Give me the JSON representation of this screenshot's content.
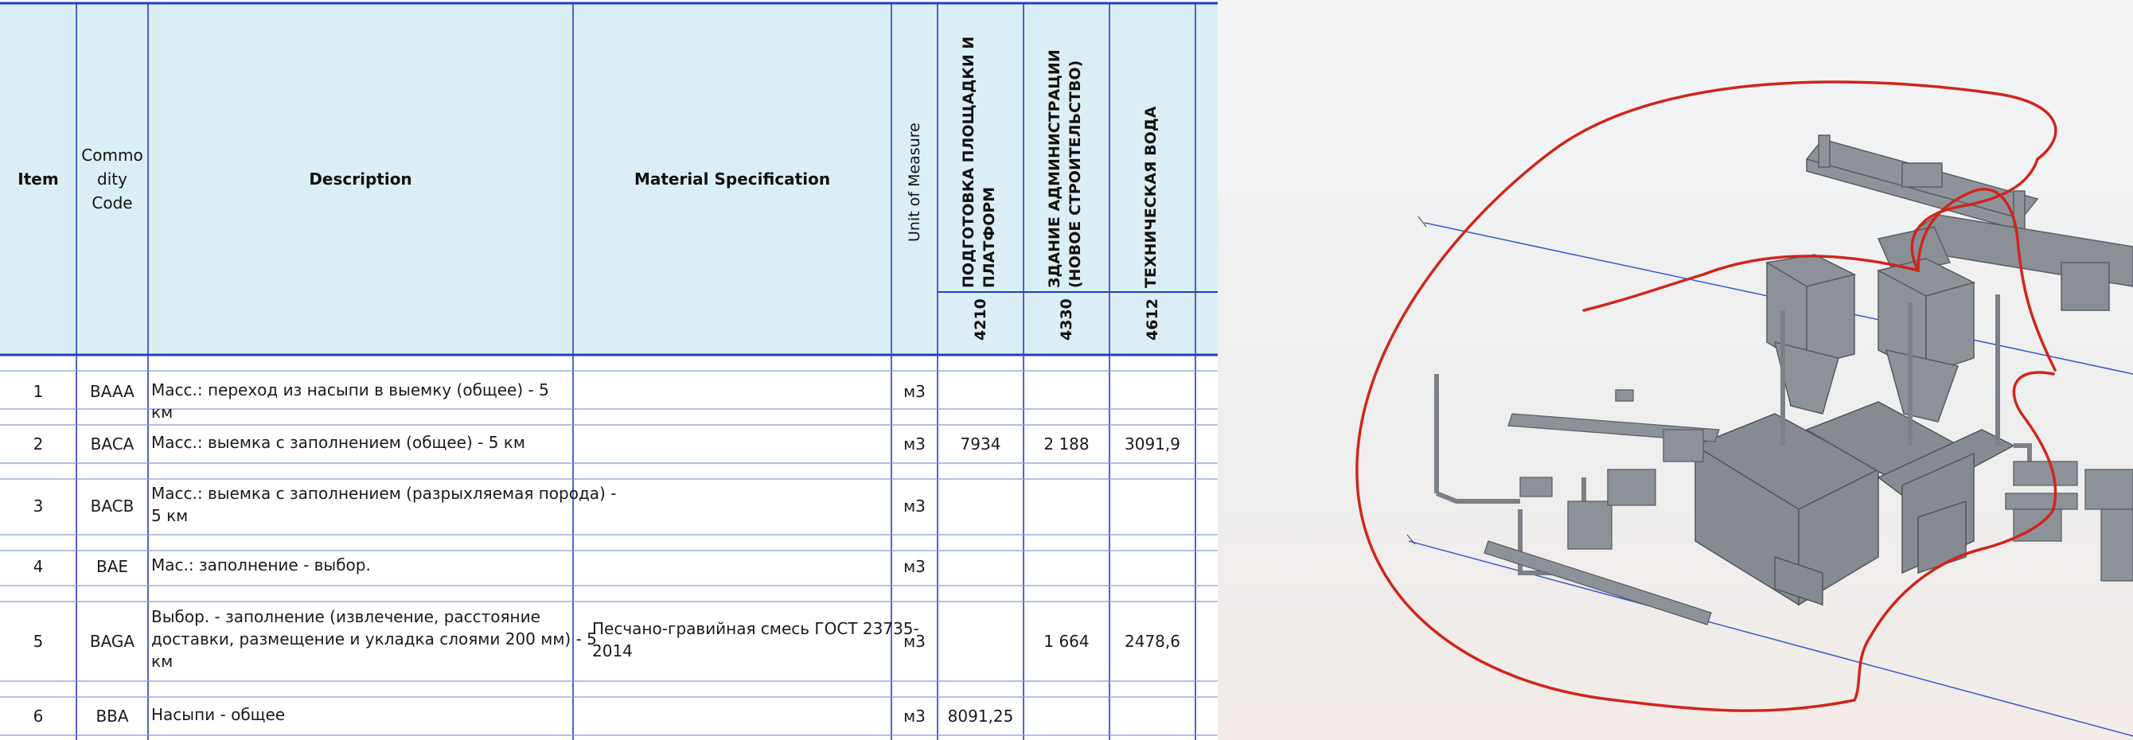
{
  "table": {
    "headers": {
      "item": "Item",
      "commodity": "Commo\ndity\nCode",
      "description": "Description",
      "material": "Material Specification",
      "unit": "Unit of Measure"
    },
    "groups": [
      {
        "title": "ПОДГОТОВКА ПЛОЩАДКИ И\nПЛАТФОРМ",
        "code": "4210"
      },
      {
        "title": "ЗДАНИЕ АДМИНИСТРАЦИИ\n(НОВОЕ СТРОИТЕЛЬСТВО)",
        "code": "4330"
      },
      {
        "title": "ТЕХНИЧЕСКАЯ ВОДА",
        "code": "4612"
      }
    ],
    "rows": [
      {
        "item": "1",
        "code": "BAAA",
        "desc": "Масс.: переход из насыпи в выемку (общее) - 5 км",
        "spec": "",
        "unit": "м3",
        "v1": "",
        "v2": "",
        "v3": ""
      },
      {
        "item": "2",
        "code": "BACA",
        "desc": "Масс.: выемка с заполнением (общее) - 5 км",
        "spec": "",
        "unit": "м3",
        "v1": "7934",
        "v2": "2 188",
        "v3": "3091,9"
      },
      {
        "item": "3",
        "code": "BACB",
        "desc": "Масс.: выемка с заполнением (разрыхляемая порода) -\n5 км",
        "spec": "",
        "unit": "м3",
        "v1": "",
        "v2": "",
        "v3": ""
      },
      {
        "item": "4",
        "code": "BAE",
        "desc": "Мас.: заполнение - выбор.",
        "spec": "",
        "unit": "м3",
        "v1": "",
        "v2": "",
        "v3": ""
      },
      {
        "item": "5",
        "code": "BAGA",
        "desc": "Выбор. - заполнение (извлечение, расстояние\nдоставки, размещение и укладка слоями 200 мм) - 5\nкм",
        "spec": "Песчано-гравийная смесь ГОСТ 23735-\n2014",
        "unit": "м3",
        "v1": "",
        "v2": "1 664",
        "v3": "2478,6"
      },
      {
        "item": "6",
        "code": "BBA",
        "desc": "Насыпи - общее",
        "spec": "",
        "unit": "м3",
        "v1": "8091,25",
        "v2": "",
        "v3": ""
      }
    ]
  },
  "colors": {
    "header_bg": "#dbeef5",
    "grid_line": "#1f3fc0",
    "row_line": "#8899dd",
    "annotation": "#d0251c",
    "steel": "#8a8f96"
  },
  "model": {
    "icon": "3d-plant-model"
  }
}
